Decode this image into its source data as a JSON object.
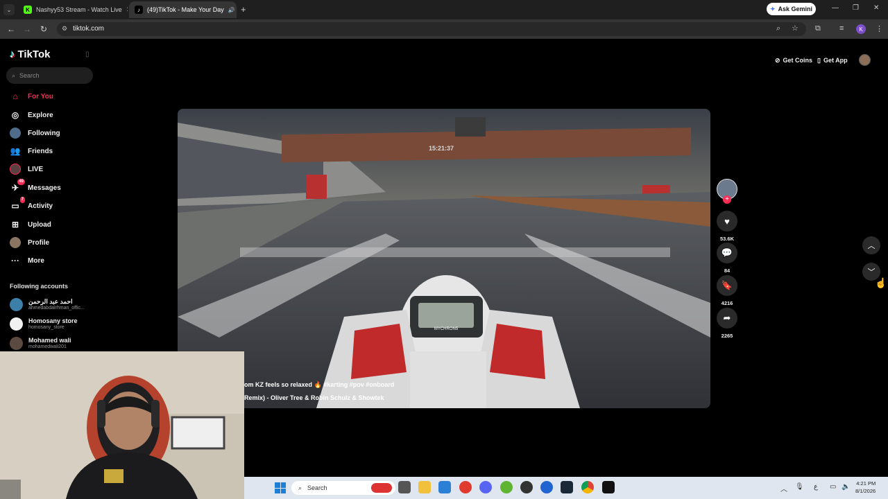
{
  "browser": {
    "tabs": [
      {
        "title": "Nashyy53 Stream - Watch Live",
        "favicon": "kick-icon",
        "active": false
      },
      {
        "title": "(49)TikTok - Make Your Day",
        "favicon": "tiktok-icon",
        "active": true
      }
    ],
    "url": "tiktok.com",
    "ask_gemini": "Ask Gemini",
    "profile_initial": "K"
  },
  "tiktok": {
    "logo": "TikTok",
    "search_placeholder": "Search",
    "nav": [
      {
        "label": "For You",
        "icon": "home-icon"
      },
      {
        "label": "Explore",
        "icon": "compass-icon"
      },
      {
        "label": "Following",
        "icon": "following-icon"
      },
      {
        "label": "Friends",
        "icon": "friends-icon"
      },
      {
        "label": "LIVE",
        "icon": "live-icon"
      },
      {
        "label": "Messages",
        "icon": "messages-icon",
        "badge": "49"
      },
      {
        "label": "Activity",
        "icon": "activity-icon",
        "badge": "7"
      },
      {
        "label": "Upload",
        "icon": "upload-icon"
      },
      {
        "label": "Profile",
        "icon": "profile-icon"
      },
      {
        "label": "More",
        "icon": "more-icon"
      }
    ],
    "following_header": "Following accounts",
    "accounts": [
      {
        "name": "احمد عبد الرحمن",
        "handle": "ahmedabdalrhman_offic..."
      },
      {
        "name": "Homosany store",
        "handle": "homosany_store"
      },
      {
        "name": "Mohamed wali",
        "handle": "mohamedwali201"
      }
    ],
    "top": {
      "get_coins": "Get Coins",
      "get_app": "Get App"
    },
    "video": {
      "caption": "om KZ feels so relaxed 🔥 #karting #pov #onboard",
      "music": "Remix) - Oliver Tree & Robin Schulz & Showtek",
      "clock_on_gantry": "15:21:37",
      "dash_brand": "MYCHRON5"
    },
    "actions": {
      "likes": "53.6K",
      "comments": "84",
      "saves": "4216",
      "shares": "2265"
    }
  },
  "taskbar": {
    "search": "Search",
    "time": "4:21 PM",
    "date": "8/1/2026",
    "lang": "ع"
  }
}
